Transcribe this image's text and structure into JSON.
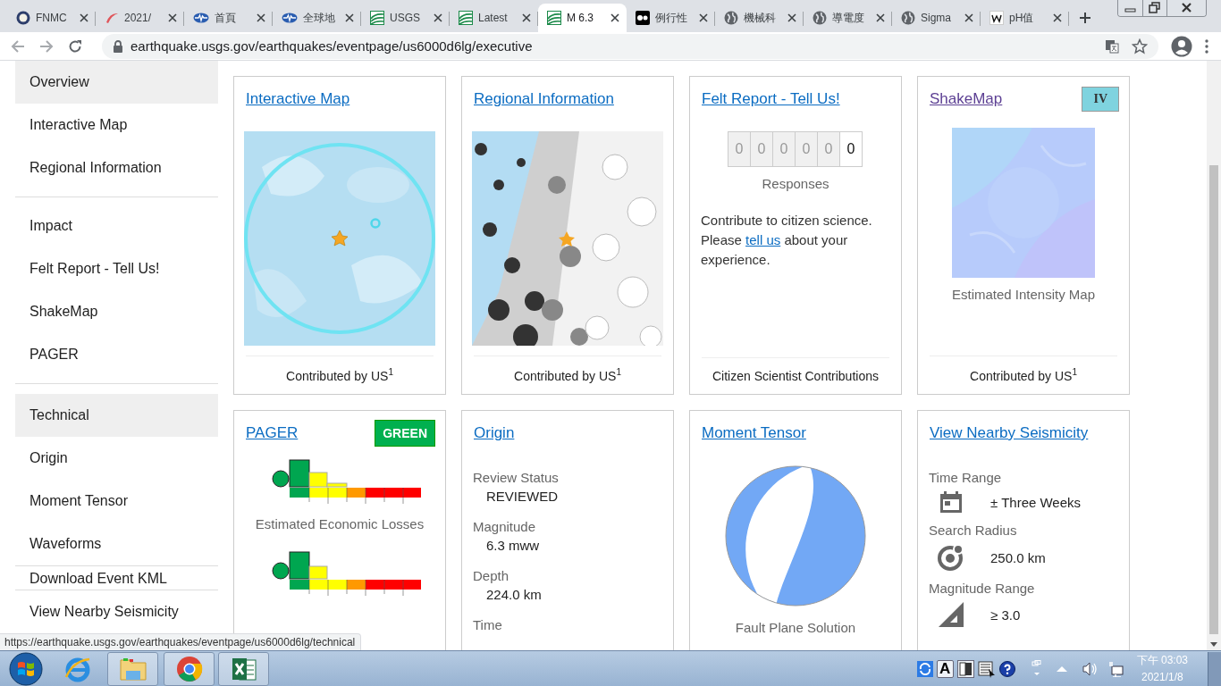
{
  "browser": {
    "tabs": [
      {
        "title": "FNMC",
        "selected": false
      },
      {
        "title": "2021/",
        "selected": false
      },
      {
        "title": "首頁",
        "selected": false
      },
      {
        "title": "全球地",
        "selected": false
      },
      {
        "title": "USGS",
        "selected": false
      },
      {
        "title": "Latest",
        "selected": false
      },
      {
        "title": "M 6.3",
        "selected": true
      },
      {
        "title": "例行性",
        "selected": false
      },
      {
        "title": "機械科",
        "selected": false
      },
      {
        "title": "導電度",
        "selected": false
      },
      {
        "title": "Sigma",
        "selected": false
      },
      {
        "title": "pH值",
        "selected": false
      }
    ],
    "address": "earthquake.usgs.gov/earthquakes/eventpage/us6000d6lg/executive"
  },
  "sidebar": {
    "groups": [
      {
        "items": [
          {
            "label": "Overview",
            "highlighted": true
          },
          {
            "label": "Interactive Map",
            "highlighted": false
          },
          {
            "label": "Regional Information",
            "highlighted": false
          }
        ]
      },
      {
        "items": [
          {
            "label": "Impact",
            "highlighted": false
          },
          {
            "label": "Felt Report - Tell Us!",
            "highlighted": false
          },
          {
            "label": "ShakeMap",
            "highlighted": false
          },
          {
            "label": "PAGER",
            "highlighted": false
          }
        ]
      },
      {
        "items": [
          {
            "label": "Technical",
            "highlighted": true
          },
          {
            "label": "Origin",
            "highlighted": false
          },
          {
            "label": "Moment Tensor",
            "highlighted": false
          },
          {
            "label": "Waveforms",
            "highlighted": false
          }
        ]
      },
      {
        "items": [
          {
            "label": "Download Event KML",
            "highlighted": false
          }
        ]
      },
      {
        "items": [
          {
            "label": "View Nearby Seismicity",
            "highlighted": false
          }
        ]
      }
    ]
  },
  "cards": [
    {
      "kind": "map",
      "title": "Interactive Map",
      "visited": false,
      "footer": "Contributed by US$^{1}$"
    },
    {
      "kind": "regional",
      "title": "Regional Information",
      "visited": false,
      "footer": "Contributed by US$^{1}$"
    },
    {
      "kind": "felt",
      "title": "Felt Report - Tell Us!",
      "visited": false,
      "digits": [
        {
          "text": "0",
          "leading": true
        },
        {
          "text": "0",
          "leading": true
        },
        {
          "text": "0",
          "leading": true
        },
        {
          "text": "0",
          "leading": true
        },
        {
          "text": "0",
          "leading": true
        },
        {
          "text": "0",
          "leading": false
        }
      ],
      "caption": "Responses",
      "paragraph": "Contribute to citizen science. Please ",
      "link": "tell us",
      "paragraph_end": " about your experience.",
      "footer": "Citizen Scientist Contributions"
    },
    {
      "kind": "intensity",
      "title": "ShakeMap",
      "visited": true,
      "badge": {
        "text": "IV",
        "color": "#7fd3df"
      },
      "caption": "Estimated Intensity Map",
      "footer": "Contributed by US$^{1}$"
    },
    {
      "kind": "pager",
      "title": "PAGER",
      "visited": false,
      "badge": {
        "text": "GREEN",
        "color": "#00b04f"
      },
      "caption": "Estimated Economic Losses"
    },
    {
      "kind": "fields",
      "title": "Origin",
      "visited": false,
      "fields": [
        {
          "label": "Review Status",
          "value": "REVIEWED"
        },
        {
          "label": "Magnitude",
          "value": "6.3 mww"
        },
        {
          "label": "Depth",
          "value": "224.0 km"
        },
        {
          "label": "Time"
        }
      ]
    },
    {
      "kind": "tensor",
      "title": "Moment Tensor",
      "visited": false,
      "caption": "Fault Plane Solution"
    },
    {
      "kind": "search",
      "title": "View Nearby Seismicity",
      "visited": false,
      "fields": [
        {
          "label": "Time Range",
          "value": "± Three Weeks"
        },
        {
          "label": "Search Radius",
          "value": "250.0 km"
        },
        {
          "label": "Magnitude Range",
          "value": "≥ 3.0"
        }
      ]
    }
  ],
  "status_url": "https://earthquake.usgs.gov/earthquakes/eventpage/us6000d6lg/technical",
  "taskbar": {
    "ime": "A",
    "time": "下午 03:03",
    "date": "2021/1/8"
  }
}
